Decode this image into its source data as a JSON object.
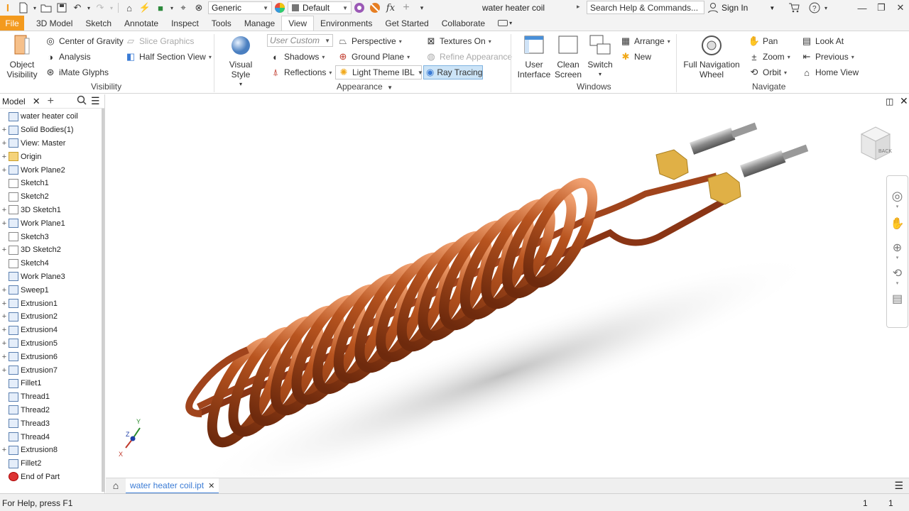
{
  "qat": {
    "material": "Generic",
    "appearance": "Default",
    "doc_title": "water heater coil",
    "search_placeholder": "Search Help & Commands...",
    "sign_in": "Sign In"
  },
  "tabs": [
    "File",
    "3D Model",
    "Sketch",
    "Annotate",
    "Inspect",
    "Tools",
    "Manage",
    "View",
    "Environments",
    "Get Started",
    "Collaborate"
  ],
  "ribbon": {
    "visibility": {
      "object_visibility": "Object\nVisibility",
      "center_of_gravity": "Center of Gravity",
      "analysis": "Analysis",
      "imate_glyphs": "iMate Glyphs",
      "slice_graphics": "Slice Graphics",
      "half_section_view": "Half Section View",
      "label": "Visibility"
    },
    "appearance": {
      "visual_style": "Visual Style",
      "user_custom": "User Custom",
      "shadows": "Shadows",
      "reflections": "Reflections",
      "perspective": "Perspective",
      "ground_plane": "Ground Plane",
      "light_theme": "Light Theme IBL",
      "textures_on": "Textures On",
      "refine_appearance": "Refine Appearance",
      "ray_tracing": "Ray Tracing",
      "label": "Appearance"
    },
    "windows": {
      "user_interface": "User\nInterface",
      "clean_screen": "Clean\nScreen",
      "switch": "Switch",
      "arrange": "Arrange",
      "new": "New",
      "label": "Windows"
    },
    "navigate": {
      "full_nav_wheel": "Full Navigation\nWheel",
      "pan": "Pan",
      "zoom": "Zoom",
      "orbit": "Orbit",
      "look_at": "Look At",
      "previous": "Previous",
      "home_view": "Home View",
      "label": "Navigate"
    }
  },
  "browser": {
    "title": "Model",
    "items": [
      {
        "label": "water heater coil",
        "exp": "",
        "icon": "part-icon"
      },
      {
        "label": "Solid Bodies(1)",
        "exp": "+",
        "icon": "solid-bodies-icon"
      },
      {
        "label": "View: Master",
        "exp": "+",
        "icon": "view-icon"
      },
      {
        "label": "Origin",
        "exp": "+",
        "icon": "folder-icon"
      },
      {
        "label": "Work Plane2",
        "exp": "+",
        "icon": "work-plane-icon"
      },
      {
        "label": "Sketch1",
        "exp": "",
        "icon": "sketch-icon"
      },
      {
        "label": "Sketch2",
        "exp": "",
        "icon": "sketch-icon"
      },
      {
        "label": "3D Sketch1",
        "exp": "+",
        "icon": "3d-sketch-icon"
      },
      {
        "label": "Work Plane1",
        "exp": "+",
        "icon": "work-plane-icon"
      },
      {
        "label": "Sketch3",
        "exp": "",
        "icon": "sketch-icon"
      },
      {
        "label": "3D Sketch2",
        "exp": "+",
        "icon": "3d-sketch-icon"
      },
      {
        "label": "Sketch4",
        "exp": "",
        "icon": "sketch-icon"
      },
      {
        "label": "Work Plane3",
        "exp": "",
        "icon": "work-plane-icon"
      },
      {
        "label": "Sweep1",
        "exp": "+",
        "icon": "sweep-icon"
      },
      {
        "label": "Extrusion1",
        "exp": "+",
        "icon": "extrusion-icon"
      },
      {
        "label": "Extrusion2",
        "exp": "+",
        "icon": "extrusion-icon"
      },
      {
        "label": "Extrusion4",
        "exp": "+",
        "icon": "extrusion-icon"
      },
      {
        "label": "Extrusion5",
        "exp": "+",
        "icon": "extrusion-icon"
      },
      {
        "label": "Extrusion6",
        "exp": "+",
        "icon": "extrusion-icon"
      },
      {
        "label": "Extrusion7",
        "exp": "+",
        "icon": "extrusion-icon"
      },
      {
        "label": "Fillet1",
        "exp": "",
        "icon": "fillet-icon"
      },
      {
        "label": "Thread1",
        "exp": "",
        "icon": "thread-icon"
      },
      {
        "label": "Thread2",
        "exp": "",
        "icon": "thread-icon"
      },
      {
        "label": "Thread3",
        "exp": "",
        "icon": "thread-icon"
      },
      {
        "label": "Thread4",
        "exp": "",
        "icon": "thread-icon"
      },
      {
        "label": "Extrusion8",
        "exp": "+",
        "icon": "extrusion-icon"
      },
      {
        "label": "Fillet2",
        "exp": "",
        "icon": "fillet-icon"
      },
      {
        "label": "End of Part",
        "exp": "",
        "icon": "end-of-part-icon"
      }
    ]
  },
  "doc_tab": "water heater coil.ipt",
  "status": {
    "help": "For Help, press F1",
    "n1": "1",
    "n2": "1"
  },
  "colors": {
    "file_tab": "#f39a1e",
    "copper": "#a0441c",
    "brass": "#e0b046",
    "ray_tracing_highlight": "#cce4f7"
  },
  "view_cube": "BACK"
}
